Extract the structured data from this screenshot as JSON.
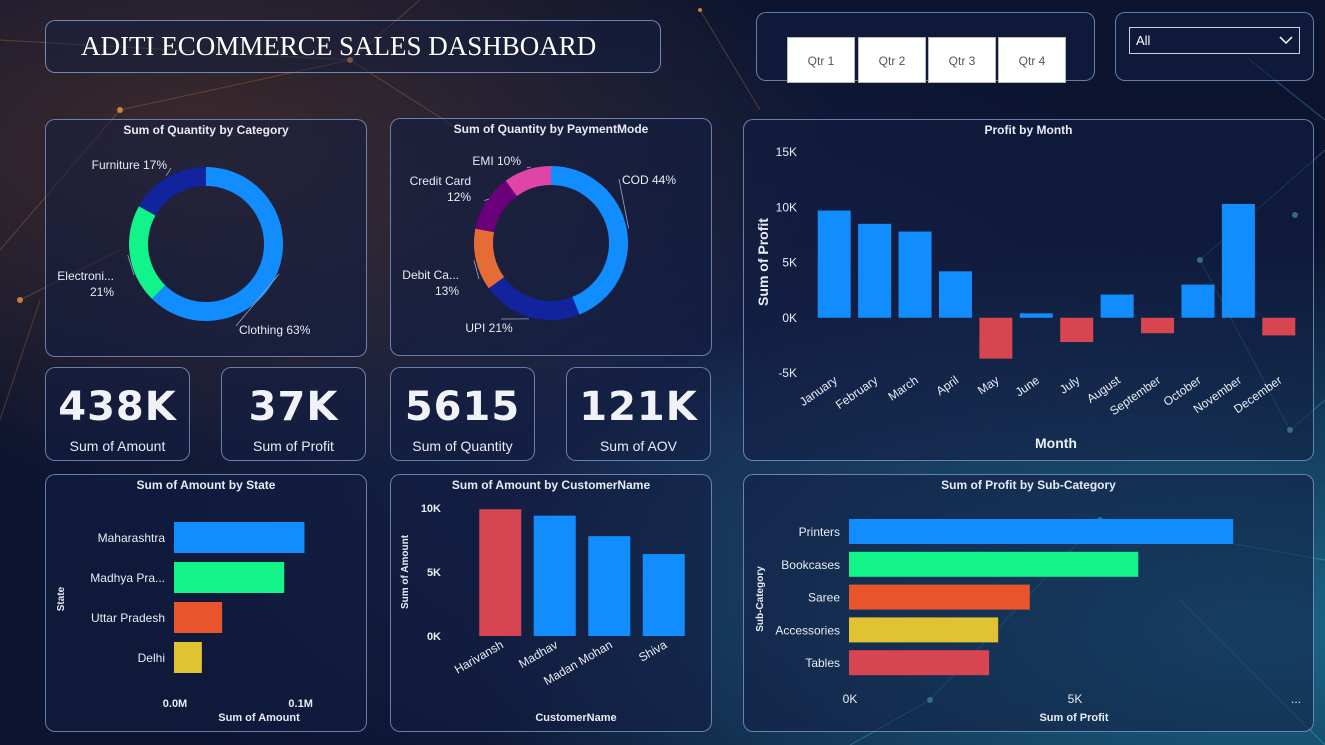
{
  "header": {
    "title": "ADITI ECOMMERCE SALES DASHBOARD"
  },
  "slicer": {
    "quarters": [
      "Qtr 1",
      "Qtr 2",
      "Qtr 3",
      "Qtr 4"
    ],
    "dropdown_value": "All"
  },
  "kpis": [
    {
      "value": "438K",
      "label": "Sum of Amount"
    },
    {
      "value": "37K",
      "label": "Sum of Profit"
    },
    {
      "value": "5615",
      "label": "Sum of Quantity"
    },
    {
      "value": "121K",
      "label": "Sum of AOV"
    }
  ],
  "chart_data": [
    {
      "type": "pie",
      "title": "Sum of Quantity by Category",
      "slices": [
        {
          "label": "Clothing",
          "value": 63,
          "color": "#118dff"
        },
        {
          "label": "Electronics",
          "display": "Electroni...",
          "value": 21,
          "color": "#12f38a"
        },
        {
          "label": "Furniture",
          "value": 17,
          "color": "#12239e"
        }
      ]
    },
    {
      "type": "pie",
      "title": "Sum of Quantity by PaymentMode",
      "slices": [
        {
          "label": "COD",
          "value": 44,
          "color": "#118dff"
        },
        {
          "label": "UPI",
          "value": 21,
          "color": "#12239e"
        },
        {
          "label": "Debit Card",
          "display": "Debit Ca...",
          "value": 13,
          "color": "#e66c37"
        },
        {
          "label": "Credit Card",
          "value": 12,
          "color": "#6b007b"
        },
        {
          "label": "EMI",
          "value": 10,
          "color": "#e044a7"
        }
      ]
    },
    {
      "type": "bar",
      "title": "Profit by Month",
      "xlabel": "Month",
      "ylabel": "Sum of Profit",
      "ylim": [
        -5000,
        15000
      ],
      "yticks": [
        "15K",
        "10K",
        "5K",
        "0K",
        "-5K"
      ],
      "categories": [
        "January",
        "February",
        "March",
        "April",
        "May",
        "June",
        "July",
        "August",
        "September",
        "October",
        "November",
        "December"
      ],
      "values": [
        9700,
        8500,
        7800,
        4200,
        -3700,
        400,
        -2200,
        2100,
        -1400,
        3000,
        10300,
        -1600
      ],
      "pos_color": "#118dff",
      "neg_color": "#d64550"
    },
    {
      "type": "bar",
      "orientation": "horizontal",
      "title": "Sum of Amount by State",
      "xlabel": "Sum of Amount",
      "ylabel": "State",
      "xticks": [
        "0.0M",
        "0.1M"
      ],
      "categories": [
        "Maharashtra",
        "Madhya Pradesh",
        "Uttar Pradesh",
        "Delhi"
      ],
      "display": [
        "Maharashtra",
        "Madhya Pra...",
        "Uttar Pradesh",
        "Delhi"
      ],
      "values": [
        103000,
        87000,
        38000,
        22000
      ],
      "colors": [
        "#118dff",
        "#12f38a",
        "#e8542b",
        "#e1c233"
      ]
    },
    {
      "type": "bar",
      "title": "Sum of Amount by CustomerName",
      "xlabel": "CustomerName",
      "ylabel": "Sum of Amount",
      "ylim": [
        0,
        10000
      ],
      "yticks": [
        "10K",
        "5K",
        "0K"
      ],
      "categories": [
        "Harivansh",
        "Madhav",
        "Madan Mohan",
        "Shiva"
      ],
      "values": [
        9900,
        9400,
        7800,
        6400
      ],
      "colors": [
        "#d64550",
        "#118dff",
        "#118dff",
        "#118dff"
      ]
    },
    {
      "type": "bar",
      "orientation": "horizontal",
      "title": "Sum of Profit by Sub-Category",
      "xlabel": "Sum of Profit",
      "ylabel": "Sub-Category",
      "xticks": [
        "0K",
        "5K",
        "..."
      ],
      "categories": [
        "Printers",
        "Bookcases",
        "Saree",
        "Accessories",
        "Tables"
      ],
      "values": [
        8500,
        6400,
        4000,
        3300,
        3100
      ],
      "colors": [
        "#118dff",
        "#12f38a",
        "#e8542b",
        "#e1c233",
        "#d64550"
      ]
    }
  ]
}
